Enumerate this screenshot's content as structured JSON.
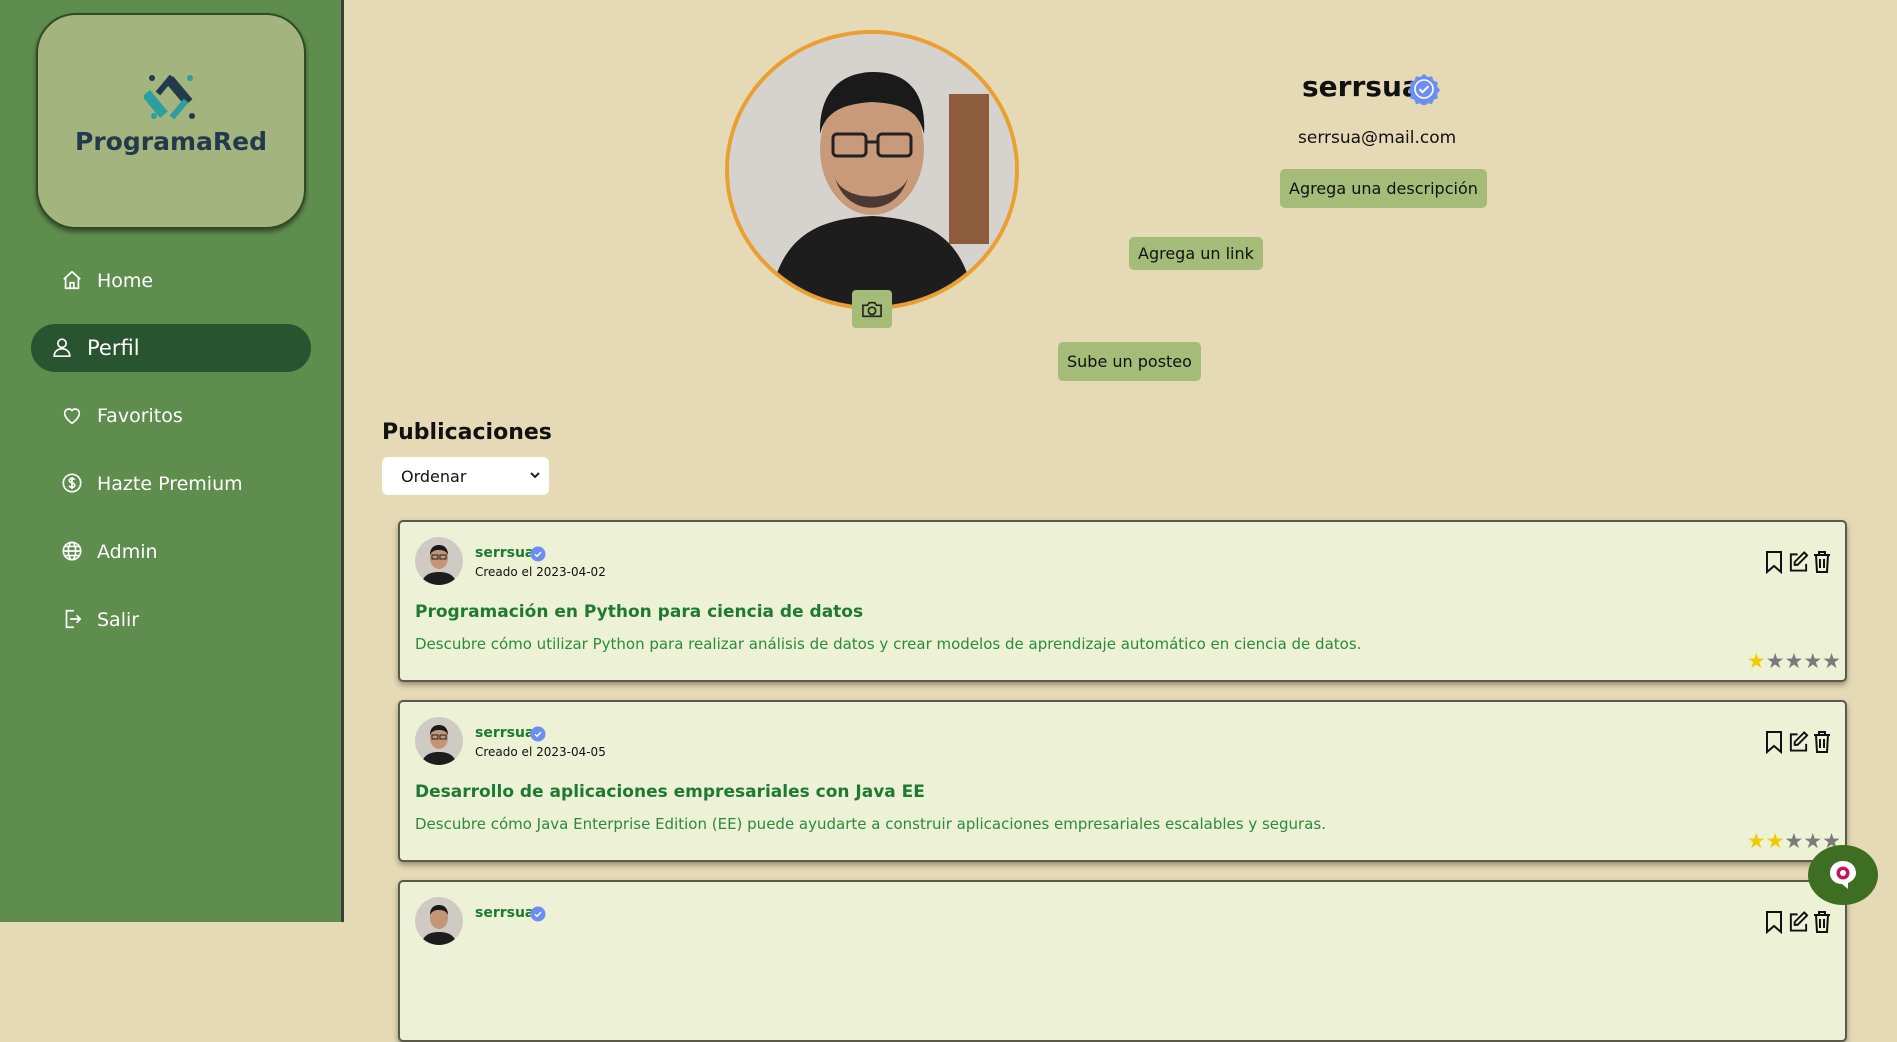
{
  "sidebar": {
    "logo_text": "ProgramaRed",
    "items": [
      {
        "label": "Home",
        "icon": "home-icon"
      },
      {
        "label": "Perfil",
        "icon": "user-icon",
        "active": true
      },
      {
        "label": "Favoritos",
        "icon": "heart-icon"
      },
      {
        "label": "Hazte Premium",
        "icon": "dollar-icon"
      },
      {
        "label": "Admin",
        "icon": "globe-icon"
      },
      {
        "label": "Salir",
        "icon": "logout-icon"
      }
    ]
  },
  "profile": {
    "username": "serrsua",
    "email": "serrsua@mail.com",
    "add_description": "Agrega una descripción",
    "add_link": "Agrega un link",
    "upload_post": "Sube un posteo"
  },
  "publications": {
    "title": "Publicaciones",
    "order_selected": "Ordenar",
    "posts": [
      {
        "user": "serrsua",
        "date": "Creado el 2023-04-02",
        "title": "Programación en Python para ciencia de datos",
        "description": "Descubre cómo utilizar Python para realizar análisis de datos y crear modelos de aprendizaje automático en ciencia de datos.",
        "rating": 1
      },
      {
        "user": "serrsua",
        "date": "Creado el 2023-04-05",
        "title": "Desarrollo de aplicaciones empresariales con Java EE",
        "description": "Descubre cómo Java Enterprise Edition (EE) puede ayudarte a construir aplicaciones empresariales escalables y seguras.",
        "rating": 2
      },
      {
        "user": "serrsua",
        "date": "",
        "title": "",
        "description": "",
        "rating": 0
      }
    ]
  },
  "colors": {
    "background": "#e5d9b6",
    "sidebar": "#5f8d4e",
    "active_nav": "#285430",
    "button": "#a4bc78",
    "card": "#edf1d6",
    "accent_ring": "#e9a030",
    "title_green": "#1e7a33",
    "verify_blue": "#6c8ef0",
    "star": "#f2cb05"
  }
}
